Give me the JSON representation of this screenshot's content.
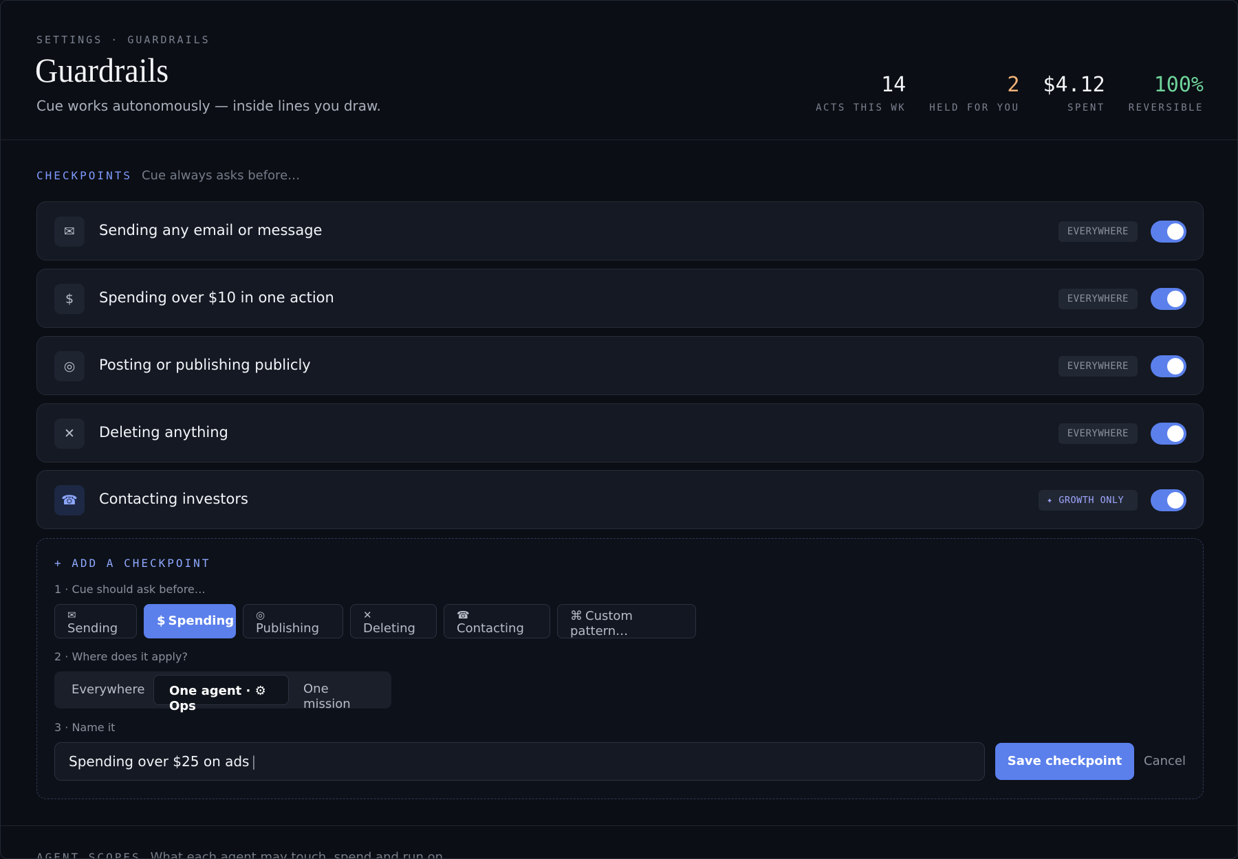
{
  "header": {
    "breadcrumb": "SETTINGS · GUARDRAILS",
    "title": "Guardrails",
    "subtitle": "Cue works autonomously — inside lines you draw.",
    "stats": [
      {
        "value": "14",
        "label": "ACTS THIS WK",
        "color": "#f3f4f7"
      },
      {
        "value": "2",
        "label": "HELD FOR YOU",
        "color": "#f2b277"
      },
      {
        "value": "$4.12",
        "label": "SPENT",
        "color": "#f3f4f7"
      },
      {
        "value": "100%",
        "label": "REVERSIBLE",
        "color": "#6fd39a"
      }
    ]
  },
  "checkpoints_section": {
    "label": "CHECKPOINTS",
    "hint": "Cue always asks before…",
    "items": [
      {
        "icon": "mail-icon",
        "glyph": "✉",
        "label": "Sending any email or message",
        "scope": "EVERYWHERE",
        "enabled": true
      },
      {
        "icon": "dollar-icon",
        "glyph": "$",
        "label": "Spending over $10 in one action",
        "scope": "EVERYWHERE",
        "enabled": true
      },
      {
        "icon": "broadcast-icon",
        "glyph": "◎",
        "label": "Posting or publishing publicly",
        "scope": "EVERYWHERE",
        "enabled": true
      },
      {
        "icon": "delete-icon",
        "glyph": "✕",
        "label": "Deleting anything",
        "scope": "EVERYWHERE",
        "enabled": true
      },
      {
        "icon": "phone-icon",
        "glyph": "☎",
        "label": "Contacting investors",
        "scope": "✦ GROWTH ONLY",
        "enabled": true
      }
    ]
  },
  "add_checkpoint": {
    "title": "+ ADD A CHECKPOINT",
    "step1": "1 · Cue should ask before…",
    "categories": [
      {
        "glyph": "✉",
        "label": "Sending",
        "selected": false
      },
      {
        "glyph": "$",
        "label": "Spending",
        "selected": true
      },
      {
        "glyph": "◎",
        "label": "Publishing",
        "selected": false
      },
      {
        "glyph": "✕",
        "label": "Deleting",
        "selected": false
      },
      {
        "glyph": "☎",
        "label": "Contacting",
        "selected": false
      },
      {
        "glyph": "⌘",
        "label": "Custom pattern…",
        "selected": false
      }
    ],
    "step2": "2 · Where does it apply?",
    "scopes": [
      {
        "label": "Everywhere",
        "active": false
      },
      {
        "label": "One agent · ⚙ Ops",
        "active": true
      },
      {
        "label": "One mission",
        "active": false
      }
    ],
    "step3": "3 · Name it",
    "name_value": "Spending over $25 on ads",
    "save_label": "Save checkpoint",
    "cancel_label": "Cancel"
  },
  "next_section": {
    "label": "AGENT SCOPES",
    "hint": "What each agent may touch, spend and run on"
  }
}
